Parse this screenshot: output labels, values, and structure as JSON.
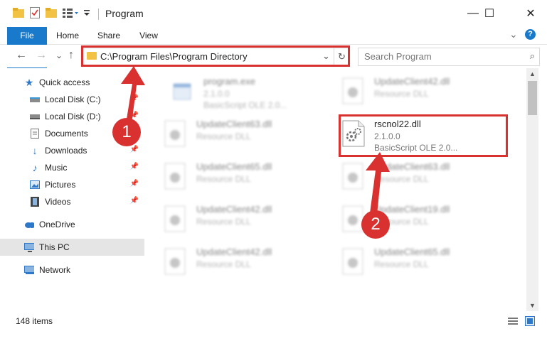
{
  "window": {
    "title": "Program",
    "minimize_glyph": "—",
    "maximize_glyph": "☐",
    "close_glyph": "✕"
  },
  "ribbon": {
    "tabs": [
      "File",
      "Home",
      "Share",
      "View"
    ],
    "expand_glyph": "⌄",
    "help_glyph": "?"
  },
  "address": {
    "path": "C:\\Program Files\\Program Directory",
    "dropdown_glyph": "⌄",
    "refresh_glyph": "↻"
  },
  "search": {
    "placeholder": "Search Program",
    "icon_glyph": "⌕"
  },
  "nav_glyphs": {
    "back": "←",
    "forward": "→",
    "recent": "⌄",
    "up": "↑"
  },
  "navpane": {
    "quick_access": "Quick access",
    "items": [
      {
        "label": "Local Disk (C:)",
        "icon": "drive-icon",
        "pinned": true
      },
      {
        "label": "Local Disk (D:)",
        "icon": "drive-icon",
        "pinned": true
      },
      {
        "label": "Documents",
        "icon": "documents-icon",
        "pinned": true
      },
      {
        "label": "Downloads",
        "icon": "downloads-icon",
        "pinned": true
      },
      {
        "label": "Music",
        "icon": "music-icon",
        "pinned": true
      },
      {
        "label": "Pictures",
        "icon": "pictures-icon",
        "pinned": true
      },
      {
        "label": "Videos",
        "icon": "videos-icon",
        "pinned": true
      }
    ],
    "onedrive": "OneDrive",
    "thispc": "This PC",
    "network": "Network"
  },
  "files": [
    {
      "name": "program.exe",
      "type": "2.1.0.0",
      "desc": "BasicScript OLE 2.0..."
    },
    {
      "name": "UpdateClient42.dll",
      "type": "Resource DLL"
    },
    {
      "name": "UpdateClient63.dll",
      "type": "Resource DLL"
    },
    {
      "name": "rscnol22.dll",
      "type": "2.1.0.0",
      "desc": "BasicScript OLE 2.0..."
    },
    {
      "name": "UpdateClient65.dll",
      "type": "Resource DLL"
    },
    {
      "name": "UpdateClient63.dll",
      "type": "Resource DLL"
    },
    {
      "name": "UpdateClient42.dll",
      "type": "Resource DLL"
    },
    {
      "name": "UpdateClient19.dll",
      "type": "Resource DLL"
    },
    {
      "name": "UpdateClient42.dll",
      "type": "Resource DLL"
    },
    {
      "name": "UpdateClient65.dll",
      "type": "Resource DLL"
    }
  ],
  "status": {
    "item_count": "148 items"
  },
  "annotations": {
    "step1": "1",
    "step2": "2"
  },
  "colors": {
    "accent": "#1979ca",
    "highlight": "#d93030"
  }
}
